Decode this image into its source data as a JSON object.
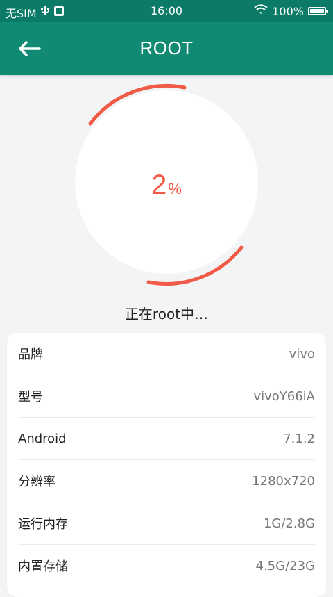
{
  "status_bar": {
    "carrier": "无SIM",
    "time": "16:00",
    "battery": "100%"
  },
  "header": {
    "title": "ROOT"
  },
  "progress": {
    "value": "2",
    "unit": "%",
    "fraction": 0.02,
    "accent_color": "#f05a47"
  },
  "status_text": "正在root中…",
  "device_info": {
    "rows": [
      {
        "label": "品牌",
        "value": "vivo"
      },
      {
        "label": "型号",
        "value": "vivoY66iA"
      },
      {
        "label": "Android",
        "value": "7.1.2"
      },
      {
        "label": "分辨率",
        "value": "1280x720"
      },
      {
        "label": "运行内存",
        "value": "1G/2.8G"
      },
      {
        "label": "内置存储",
        "value": "4.5G/23G"
      }
    ]
  },
  "theme": {
    "primary": "#118a73",
    "status_bar": "#0b7a66"
  }
}
